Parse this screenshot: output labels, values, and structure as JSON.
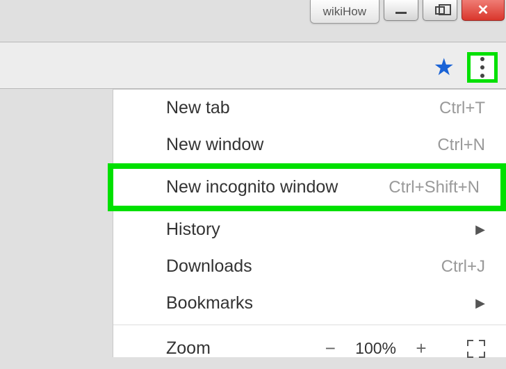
{
  "titlebar": {
    "tab_label": "wikiHow"
  },
  "toolbar": {
    "star_glyph": "★"
  },
  "menu": {
    "new_tab": {
      "label": "New tab",
      "shortcut": "Ctrl+T"
    },
    "new_window": {
      "label": "New window",
      "shortcut": "Ctrl+N"
    },
    "incognito": {
      "label": "New incognito window",
      "shortcut": "Ctrl+Shift+N"
    },
    "history": {
      "label": "History"
    },
    "downloads": {
      "label": "Downloads",
      "shortcut": "Ctrl+J"
    },
    "bookmarks": {
      "label": "Bookmarks"
    },
    "zoom": {
      "label": "Zoom",
      "minus": "−",
      "value": "100%",
      "plus": "+"
    }
  }
}
